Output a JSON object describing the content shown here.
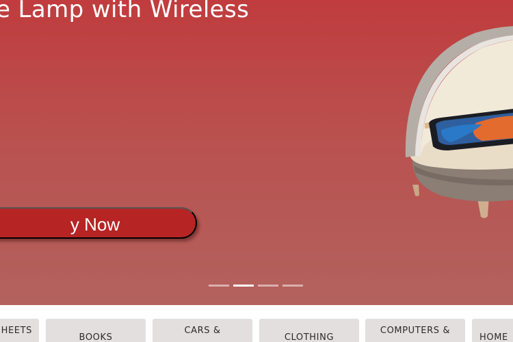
{
  "hero": {
    "title": "e Lamp with Wireless",
    "cta_label": "y Now",
    "slide_count": 4,
    "active_slide": 2,
    "colors": {
      "background": "#c03c3e",
      "cta": "#b62424"
    }
  },
  "carousel_dots": [
    {
      "label": "slide-1",
      "active": false
    },
    {
      "label": "slide-2",
      "active": true
    },
    {
      "label": "slide-3",
      "active": false
    },
    {
      "label": "slide-4",
      "active": false
    }
  ],
  "categories": [
    {
      "label": "HEETS"
    },
    {
      "label": "BOOKS"
    },
    {
      "label": "CARS &"
    },
    {
      "label": "CLOTHING"
    },
    {
      "label": "COMPUTERS &"
    },
    {
      "label": "HOME"
    }
  ]
}
